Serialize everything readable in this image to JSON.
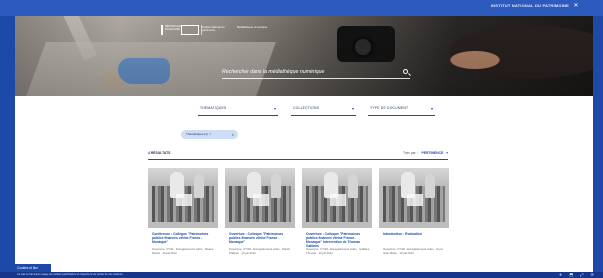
{
  "browser": {
    "title": "INSTITUT NATIONAL DU PATRIMOINE",
    "close_glyph": "✕"
  },
  "header": {
    "logo_marianne_lines": [
      "RÉPUBLIQUE",
      "FRANÇAISE"
    ],
    "logo_institut_text": "Institut national du patrimoine",
    "logo_ministry_text": "Médiathèque numérique"
  },
  "hero": {
    "search_placeholder": "Rechercher dans la médiathèque numérique"
  },
  "filters": [
    {
      "label": "Thématiques"
    },
    {
      "label": "Collections"
    },
    {
      "label": "Type de document"
    }
  ],
  "active_filter": {
    "label": "Thématiques (1) : I ",
    "remove_glyph": "×"
  },
  "results": {
    "count_label": "4 résultats",
    "sort_label": "Trier par :",
    "sort_value": "Pertinence",
    "caret": "▾"
  },
  "cards": [
    {
      "title": "Conférence : Collègue \"Patrimoines publics financés vitrine France - Monaque\"",
      "meta": "Ouverture, 7/7/11 - Enregistrement vidéo · Musée Daniel · 10 juil 2012"
    },
    {
      "title": "Ouverture : Colloque \"Patrimoines publics financés vitrine France - Monaque\"",
      "meta": "Ouverture, 7/7/18 - Enregistrement vidéo · Martin Philippe · 10 juil 2012"
    },
    {
      "title": "Ouverture : Colloque \"Patrimoines publics financés vitrine France - Monaque\" Intervention de Thomas Gaillans",
      "meta": "Ouverture, 7/7/18 - Enregistrement vidéo · Gaillans Thomas · 10 juil 2012"
    },
    {
      "title": "Introduction : Évaluation",
      "meta": "Ouverture, 7/7/18 - Enregistrement vidéo · Gens Jean Marie · 10 juil 2012"
    }
  ],
  "footer": {
    "cookie_title": "Cookies et flux",
    "text": "Ce site ne fait aucun usage de cookies publicitaires et respecte la vie privée de ses visiteurs.",
    "icons": "✈ ⬒ ⤢ ⟳"
  }
}
